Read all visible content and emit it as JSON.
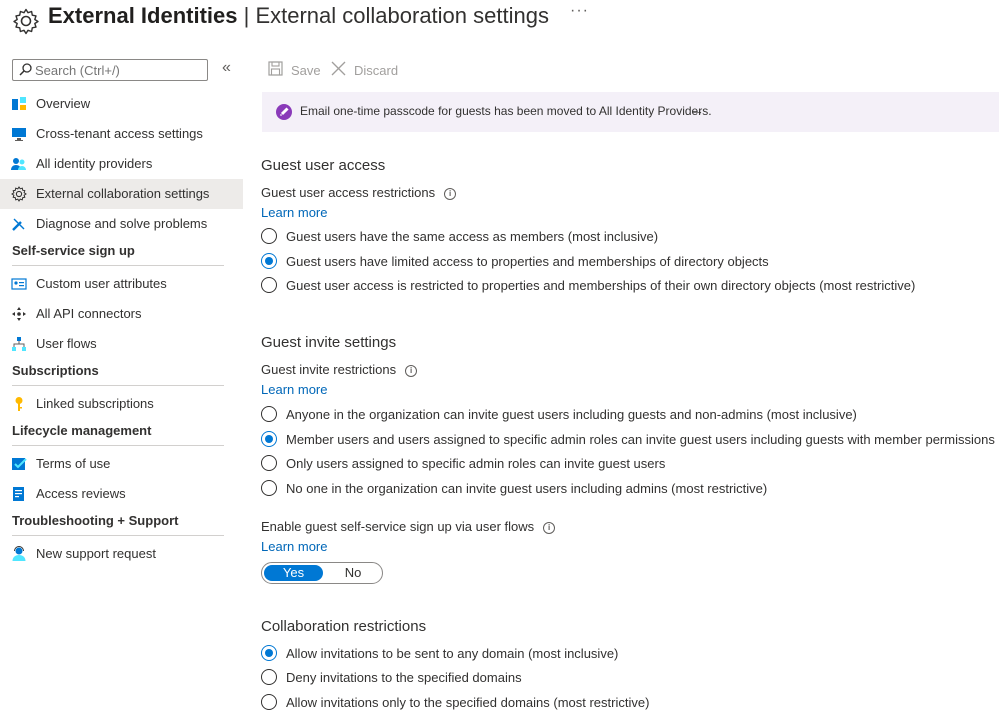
{
  "header": {
    "title_bold": "External Identities",
    "title_rest": " | External collaboration settings",
    "more": "···"
  },
  "sidebar": {
    "search_placeholder": "Search (Ctrl+/)",
    "collapse": "«",
    "items": [
      {
        "label": "Overview",
        "icon": "overview-icon"
      },
      {
        "label": "Cross-tenant access settings",
        "icon": "monitor-icon"
      },
      {
        "label": "All identity providers",
        "icon": "users-icon"
      },
      {
        "label": "External collaboration settings",
        "icon": "gear-icon",
        "active": true
      },
      {
        "label": "Diagnose and solve problems",
        "icon": "wrench-icon"
      }
    ],
    "sections": [
      {
        "title": "Self-service sign up",
        "items": [
          {
            "label": "Custom user attributes",
            "icon": "id-card-icon"
          },
          {
            "label": "All API connectors",
            "icon": "connector-icon"
          },
          {
            "label": "User flows",
            "icon": "flow-icon"
          }
        ]
      },
      {
        "title": "Subscriptions",
        "items": [
          {
            "label": "Linked subscriptions",
            "icon": "key-icon"
          }
        ]
      },
      {
        "title": "Lifecycle management",
        "items": [
          {
            "label": "Terms of use",
            "icon": "checklist-icon"
          },
          {
            "label": "Access reviews",
            "icon": "review-icon"
          }
        ]
      },
      {
        "title": "Troubleshooting + Support",
        "items": [
          {
            "label": "New support request",
            "icon": "support-icon"
          }
        ]
      }
    ]
  },
  "toolbar": {
    "save": "Save",
    "discard": "Discard"
  },
  "banner": {
    "text": "Email one-time passcode for guests has been moved to All Identity Providers.",
    "arrow": "→"
  },
  "guest_access": {
    "heading": "Guest user access",
    "label": "Guest user access restrictions",
    "learn_more": "Learn more",
    "options": [
      "Guest users have the same access as members (most inclusive)",
      "Guest users have limited access to properties and memberships of directory objects",
      "Guest user access is restricted to properties and memberships of their own directory objects (most restrictive)"
    ],
    "selected": 1
  },
  "guest_invite": {
    "heading": "Guest invite settings",
    "label": "Guest invite restrictions",
    "learn_more": "Learn more",
    "options": [
      "Anyone in the organization can invite guest users including guests and non-admins (most inclusive)",
      "Member users and users assigned to specific admin roles can invite guest users including guests with member permissions",
      "Only users assigned to specific admin roles can invite guest users",
      "No one in the organization can invite guest users including admins (most restrictive)"
    ],
    "selected": 1
  },
  "self_service": {
    "label": "Enable guest self-service sign up via user flows",
    "learn_more": "Learn more",
    "yes": "Yes",
    "no": "No",
    "value": "Yes"
  },
  "collab": {
    "heading": "Collaboration restrictions",
    "options": [
      "Allow invitations to be sent to any domain (most inclusive)",
      "Deny invitations to the specified domains",
      "Allow invitations only to the specified domains (most restrictive)"
    ],
    "selected": 0
  },
  "colors": {
    "accent": "#0078d4",
    "link": "#0067b8",
    "banner_bg": "#f4f0f8",
    "active_bg": "#edebe9"
  }
}
